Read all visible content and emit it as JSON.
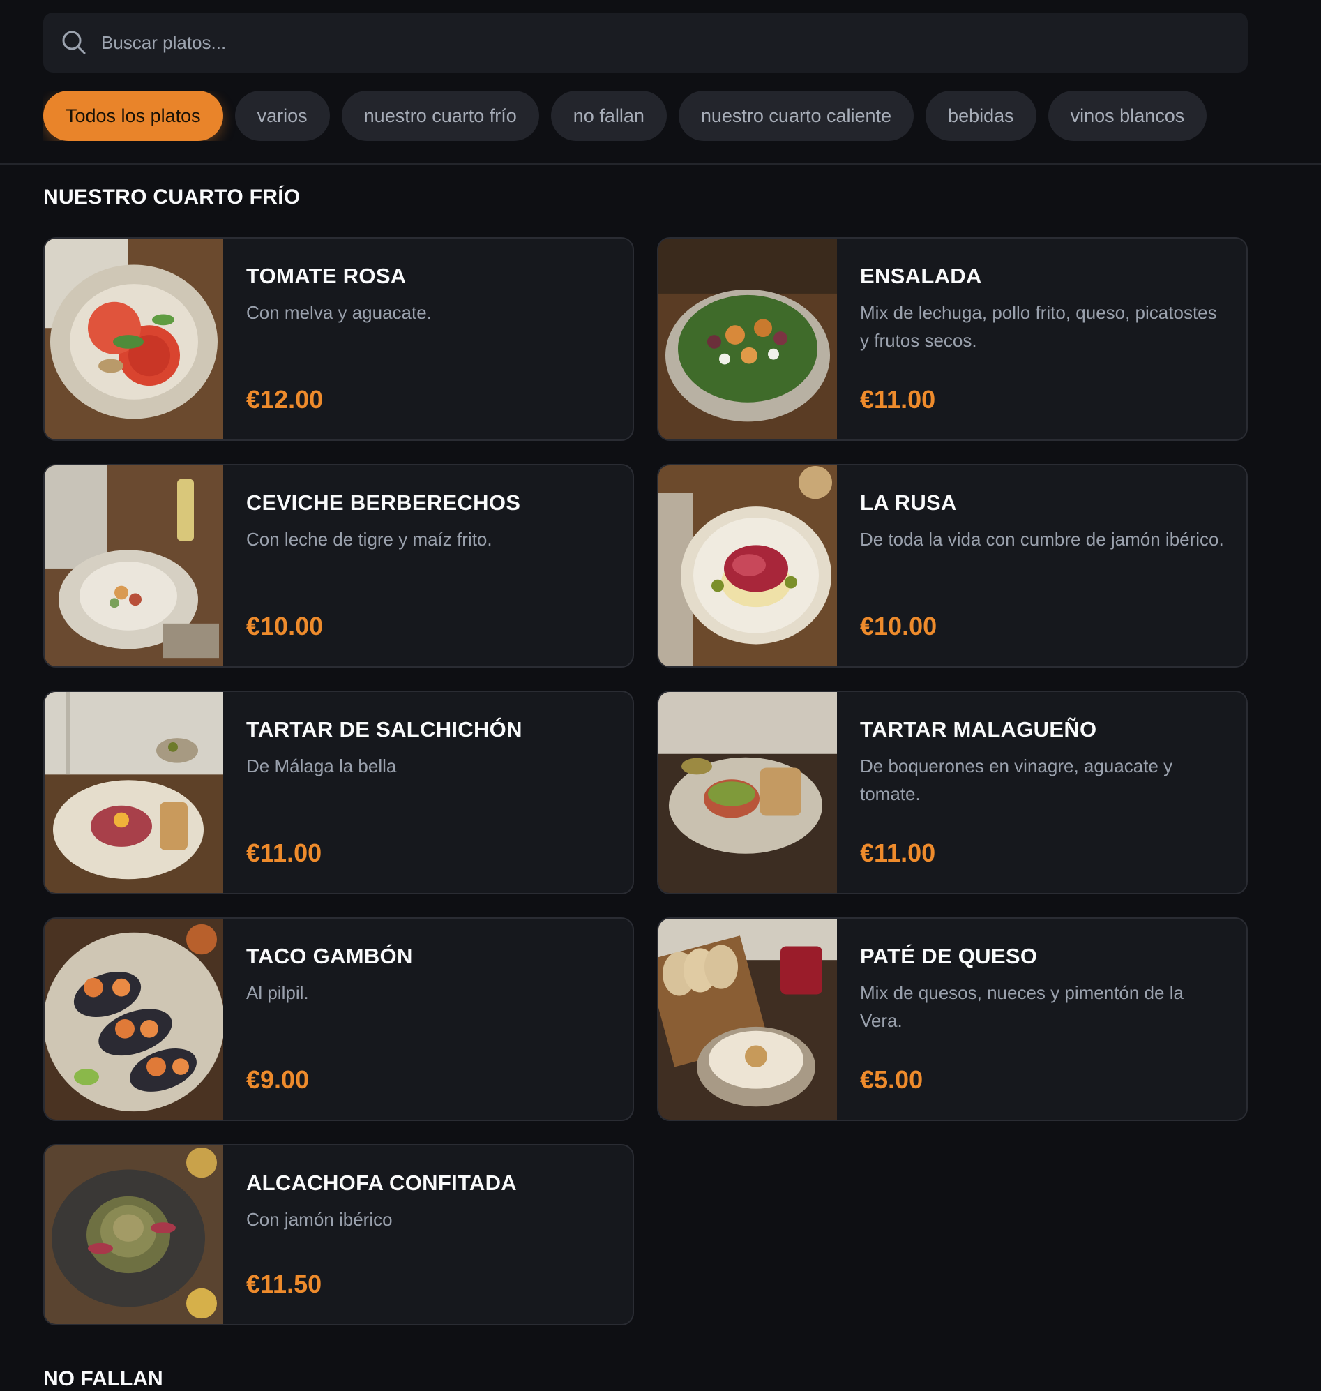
{
  "search": {
    "placeholder": "Buscar platos..."
  },
  "categories": [
    "Todos los platos",
    "varios",
    "nuestro cuarto frío",
    "no fallan",
    "nuestro cuarto caliente",
    "bebidas",
    "vinos blancos"
  ],
  "active_category": "Todos los platos",
  "colors": {
    "accent": "#e9842a",
    "price": "#ee8b2c",
    "background": "#0e0f13",
    "card": "#16181d"
  },
  "section": {
    "title": "NUESTRO CUARTO FRÍO",
    "items": [
      {
        "name": "TOMATE ROSA",
        "description": "Con melva y aguacate.",
        "price": "€12.00",
        "image": "tomato-salad-photo"
      },
      {
        "name": "ENSALADA",
        "description": "Mix de lechuga, pollo frito, queso, picatostes y frutos secos.",
        "price": "€11.00",
        "image": "salad-bowl-photo"
      },
      {
        "name": "CEVICHE BERBERECHOS",
        "description": "Con leche de tigre y maíz frito.",
        "price": "€10.00",
        "image": "ceviche-photo"
      },
      {
        "name": "LA RUSA",
        "description": "De toda la vida con cumbre de jamón ibérico.",
        "price": "€10.00",
        "image": "russian-salad-photo"
      },
      {
        "name": "TARTAR DE SALCHICHÓN",
        "description": "De Málaga la bella",
        "price": "€11.00",
        "image": "tartare-salchichon-photo"
      },
      {
        "name": "TARTAR MALAGUEÑO",
        "description": "De boquerones en vinagre, aguacate y tomate.",
        "price": "€11.00",
        "image": "tartare-malagueno-photo"
      },
      {
        "name": "TACO GAMBÓN",
        "description": "Al pilpil.",
        "price": "€9.00",
        "image": "shrimp-taco-photo"
      },
      {
        "name": "PATÉ DE QUESO",
        "description": "Mix de quesos, nueces y pimentón de la Vera.",
        "price": "€5.00",
        "image": "cheese-pate-photo"
      },
      {
        "name": "ALCACHOFA CONFITADA",
        "description": "Con jamón ibérico",
        "price": "€11.50",
        "image": "artichoke-photo"
      }
    ]
  },
  "next_section": {
    "title": "NO FALLAN"
  }
}
